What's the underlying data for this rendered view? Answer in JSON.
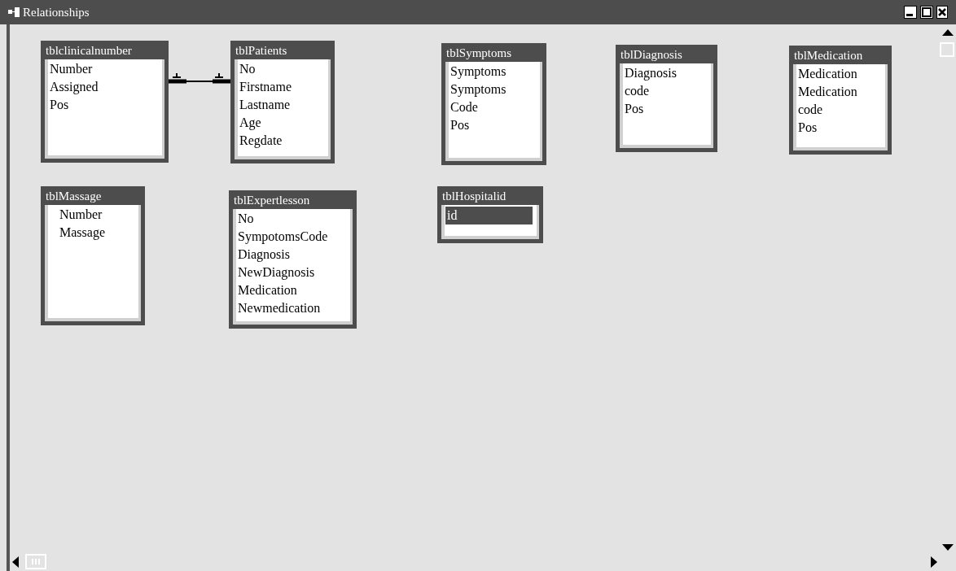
{
  "window": {
    "title": "Relationships"
  },
  "tables": [
    {
      "name": "tblclinicalnumber",
      "fields": [
        {
          "label": "Number",
          "selected": false
        },
        {
          "label": "Assigned",
          "selected": false
        },
        {
          "label": "Pos",
          "selected": false
        }
      ]
    },
    {
      "name": "tblPatients",
      "fields": [
        {
          "label": "No",
          "selected": false
        },
        {
          "label": "Firstname",
          "selected": false
        },
        {
          "label": "Lastname",
          "selected": false
        },
        {
          "label": "Age",
          "selected": false
        },
        {
          "label": "Regdate",
          "selected": false
        }
      ]
    },
    {
      "name": "tblSymptoms",
      "fields": [
        {
          "label": "Symptoms",
          "selected": false
        },
        {
          "label": "Symptoms",
          "selected": false
        },
        {
          "label": "Code",
          "selected": false
        },
        {
          "label": "Pos",
          "selected": false
        }
      ]
    },
    {
      "name": "tblDiagnosis",
      "fields": [
        {
          "label": "Diagnosis",
          "selected": false
        },
        {
          "label": "code",
          "selected": false
        },
        {
          "label": "Pos",
          "selected": false
        }
      ]
    },
    {
      "name": "tblMedication",
      "fields": [
        {
          "label": "Medication",
          "selected": false
        },
        {
          "label": "Medication",
          "selected": false
        },
        {
          "label": "code",
          "selected": false
        },
        {
          "label": "Pos",
          "selected": false
        }
      ]
    },
    {
      "name": "tblMassage",
      "fields": [
        {
          "label": "Number",
          "selected": false
        },
        {
          "label": "Massage",
          "selected": false
        }
      ]
    },
    {
      "name": "tblExpertlesson",
      "fields": [
        {
          "label": "No",
          "selected": false
        },
        {
          "label": "SympotomsCode",
          "selected": false
        },
        {
          "label": "Diagnosis",
          "selected": false
        },
        {
          "label": "NewDiagnosis",
          "selected": false
        },
        {
          "label": "Medication",
          "selected": false
        },
        {
          "label": "Newmedication",
          "selected": false
        }
      ]
    },
    {
      "name": "tblHospitalid",
      "fields": [
        {
          "label": "id",
          "selected": true
        }
      ]
    }
  ]
}
